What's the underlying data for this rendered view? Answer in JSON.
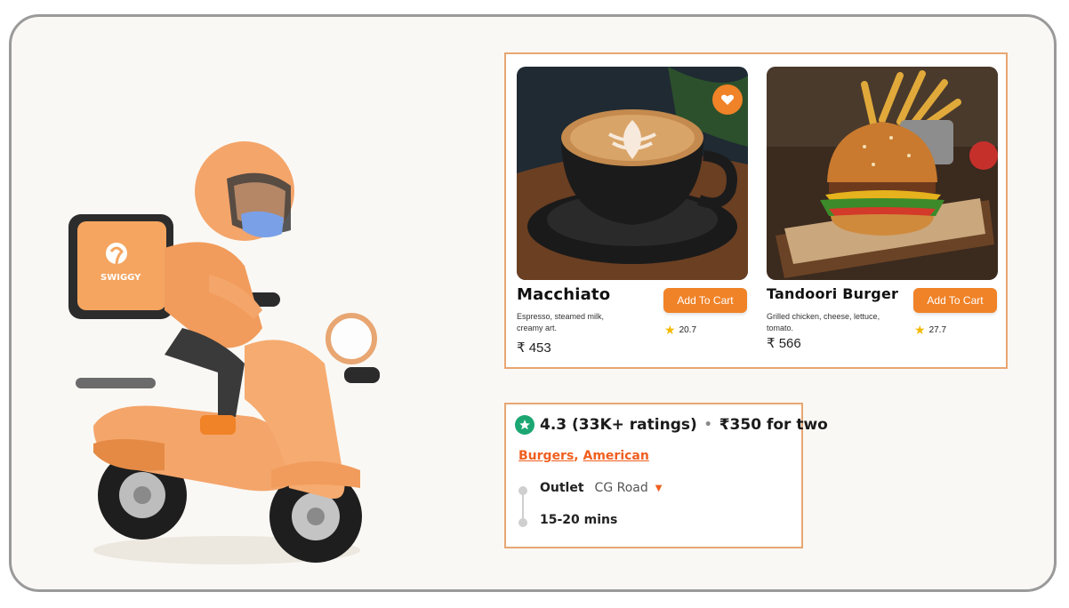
{
  "brand": {
    "name": "SWIGGY",
    "accent": "#f08227",
    "rating_green": "#1ba672",
    "link_color": "#f05f1f"
  },
  "menu": {
    "items": [
      {
        "name": "Macchiato",
        "description": "Espresso, steamed milk, creamy art.",
        "price": "₹ 453",
        "add_label": "Add To Cart",
        "rating": "20.7",
        "image": "coffee-cup-icon",
        "favorite": true
      },
      {
        "name": "Tandoori Burger",
        "description": "Grilled chicken, cheese, lettuce, tomato.",
        "price": "₹ 566",
        "add_label": "Add To Cart",
        "rating": "27.7",
        "image": "burger-icon",
        "favorite": false
      }
    ]
  },
  "restaurant": {
    "rating": "4.3 (33K+ ratings)",
    "separator": "•",
    "cost": "₹350 for two",
    "cuisines": [
      "Burgers",
      "American"
    ],
    "cuisine_separator": ",",
    "outlet_label": "Outlet",
    "outlet_value": "CG Road",
    "delivery_time": "15-20 mins"
  }
}
